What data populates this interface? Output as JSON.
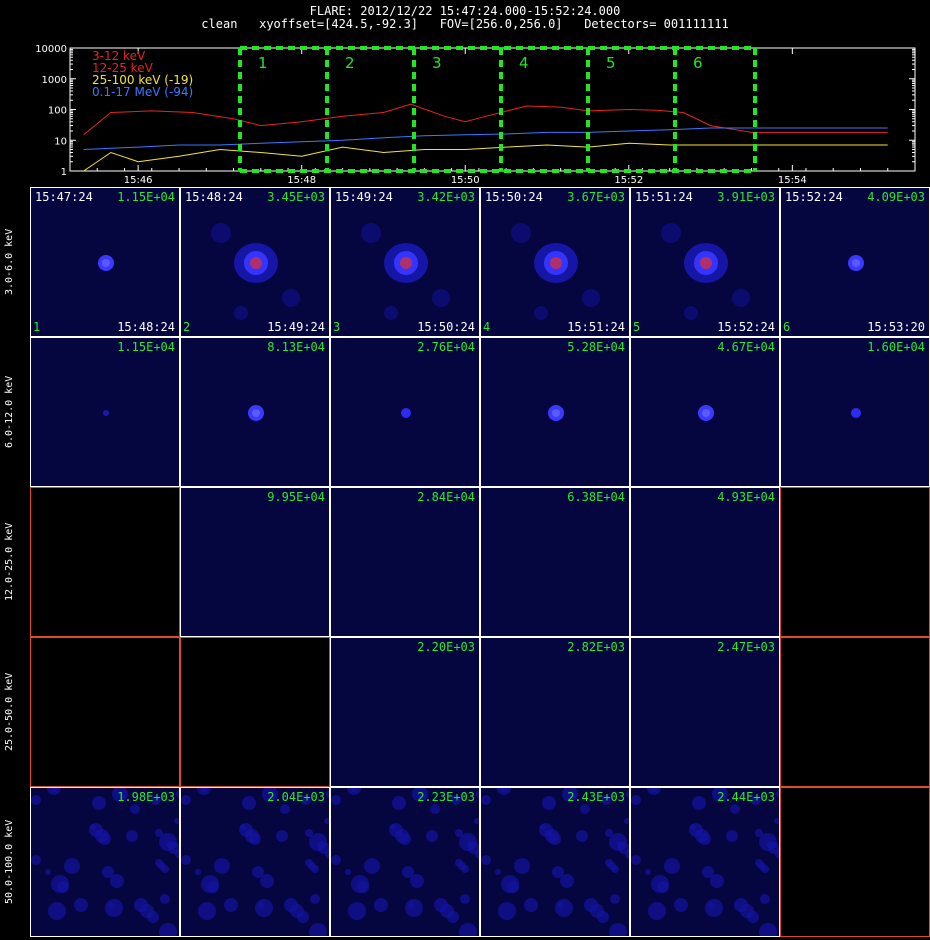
{
  "header": {
    "line1": "FLARE: 2012/12/22 15:47:24.000-15:52:24.000",
    "line2": "clean   xyoffset=[424.5,-92.3]   FOV=[256.0,256.0]   Detectors= 001111111"
  },
  "chart_data": {
    "type": "line",
    "title": "",
    "ylabel": "",
    "xlabel": "",
    "yscale": "log",
    "ylim": [
      1,
      10000
    ],
    "y_ticks": [
      "10000",
      "1000",
      "100",
      "10",
      "1"
    ],
    "x_ticks": [
      "15:46",
      "15:48",
      "15:50",
      "15:52",
      "15:54"
    ],
    "legend_placement": "top-left",
    "series": [
      {
        "name": "3-12 keV",
        "color": "#e8231e",
        "x": [
          "15:45:20",
          "15:45:40",
          "15:46:10",
          "15:46:40",
          "15:47:10",
          "15:47:30",
          "15:48:00",
          "15:48:30",
          "15:49:00",
          "15:49:20",
          "15:49:45",
          "15:50:00",
          "15:50:15",
          "15:50:45",
          "15:51:10",
          "15:51:30",
          "15:52:00",
          "15:52:20",
          "15:52:40",
          "15:53:00",
          "15:53:30",
          "15:54:00",
          "15:54:30",
          "15:55:10"
        ],
        "y": [
          15,
          80,
          90,
          80,
          50,
          30,
          40,
          60,
          80,
          150,
          60,
          40,
          60,
          130,
          120,
          90,
          100,
          95,
          80,
          30,
          18,
          18,
          18,
          18
        ]
      },
      {
        "name": "12-25 keV",
        "color": "#e8231e",
        "x": [],
        "y": []
      },
      {
        "name": "25-100 keV (-19)",
        "color": "#f4e43c",
        "x": [
          "15:45:20",
          "15:45:40",
          "15:46:00",
          "15:46:30",
          "15:47:00",
          "15:47:30",
          "15:48:00",
          "15:48:30",
          "15:49:00",
          "15:49:30",
          "15:50:00",
          "15:50:30",
          "15:51:00",
          "15:51:30",
          "15:52:00",
          "15:52:30",
          "15:53:00",
          "15:53:30",
          "15:54:00",
          "15:54:30",
          "15:55:10"
        ],
        "y": [
          1,
          4,
          2,
          3,
          5,
          4,
          3,
          6,
          4,
          5,
          5,
          6,
          7,
          6,
          8,
          7,
          7,
          7,
          7,
          7,
          7
        ]
      },
      {
        "name": "0.1-17 MeV (-94)",
        "color": "#3a78ff",
        "x": [
          "15:45:20",
          "15:46:00",
          "15:46:30",
          "15:47:00",
          "15:47:30",
          "15:48:00",
          "15:48:30",
          "15:49:00",
          "15:49:30",
          "15:50:00",
          "15:50:30",
          "15:51:00",
          "15:51:30",
          "15:52:00",
          "15:52:30",
          "15:53:00",
          "15:53:30",
          "15:54:00",
          "15:54:30",
          "15:55:10"
        ],
        "y": [
          5,
          6,
          7,
          7,
          8,
          9,
          10,
          12,
          14,
          15,
          16,
          18,
          18,
          20,
          22,
          25,
          25,
          25,
          25,
          25
        ]
      }
    ],
    "intervals": [
      "1",
      "2",
      "3",
      "4",
      "5",
      "6"
    ],
    "interval_color": "#22e622"
  },
  "row_labels": [
    "3.0-6.0 keV",
    "6.0-12.0 keV",
    "12.0-25.0 keV",
    "25.0-50.0 keV",
    "50.0-100.0 keV"
  ],
  "grid": [
    [
      {
        "max": "1.15E+04",
        "t0": "15:47:24",
        "t1": "15:48:24",
        "idx": "1",
        "img": "dot"
      },
      {
        "max": "3.45E+03",
        "t0": "15:48:24",
        "t1": "15:49:24",
        "idx": "2",
        "img": "blob"
      },
      {
        "max": "3.42E+03",
        "t0": "15:49:24",
        "t1": "15:50:24",
        "idx": "3",
        "img": "blob"
      },
      {
        "max": "3.67E+03",
        "t0": "15:50:24",
        "t1": "15:51:24",
        "idx": "4",
        "img": "blob"
      },
      {
        "max": "3.91E+03",
        "t0": "15:51:24",
        "t1": "15:52:24",
        "idx": "5",
        "img": "blob"
      },
      {
        "max": "4.09E+03",
        "t0": "15:52:24",
        "t1": "15:53:20",
        "idx": "6",
        "img": "dot"
      }
    ],
    [
      {
        "max": "1.15E+04",
        "img": "faint"
      },
      {
        "max": "8.13E+04",
        "img": "dot"
      },
      {
        "max": "2.76E+04",
        "img": "small"
      },
      {
        "max": "5.28E+04",
        "img": "dot"
      },
      {
        "max": "4.67E+04",
        "img": "dot"
      },
      {
        "max": "1.60E+04",
        "img": "small"
      }
    ],
    [
      {
        "empty": true
      },
      {
        "max": "9.95E+04",
        "img": "plain"
      },
      {
        "max": "2.84E+04",
        "img": "plain"
      },
      {
        "max": "6.38E+04",
        "img": "plain"
      },
      {
        "max": "4.93E+04",
        "img": "plain"
      },
      {
        "empty": true
      }
    ],
    [
      {
        "empty": true
      },
      {
        "empty": true
      },
      {
        "max": "2.20E+03",
        "img": "plain"
      },
      {
        "max": "2.82E+03",
        "img": "plain"
      },
      {
        "max": "2.47E+03",
        "img": "plain"
      },
      {
        "empty": true
      }
    ],
    [
      {
        "max": "1.98E+03",
        "img": "noise"
      },
      {
        "max": "2.04E+03",
        "img": "noise"
      },
      {
        "max": "2.23E+03",
        "img": "noise"
      },
      {
        "max": "2.43E+03",
        "img": "noise"
      },
      {
        "max": "2.44E+03",
        "img": "noise"
      },
      {
        "empty": true
      }
    ]
  ]
}
